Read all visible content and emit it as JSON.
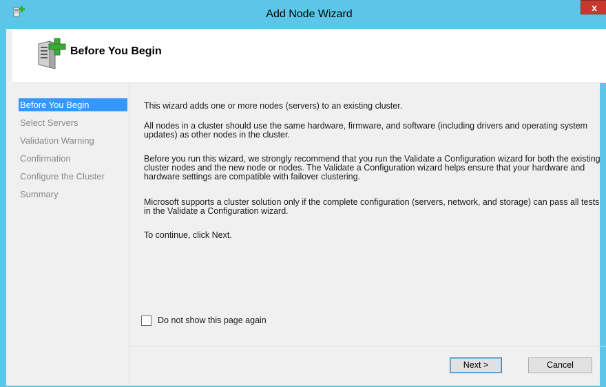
{
  "window": {
    "title": "Add Node Wizard",
    "close_label": "x",
    "app_icon": "add-node-icon",
    "accent_color": "#5bc6e8"
  },
  "header": {
    "title": "Before You Begin",
    "icon": "server-add-icon"
  },
  "sidebar": {
    "items": [
      {
        "label": "Before You Begin",
        "active": true
      },
      {
        "label": "Select Servers",
        "active": false
      },
      {
        "label": "Validation Warning",
        "active": false
      },
      {
        "label": "Confirmation",
        "active": false
      },
      {
        "label": "Configure the Cluster",
        "active": false
      },
      {
        "label": "Summary",
        "active": false
      }
    ],
    "selection_color": "#3399ff"
  },
  "content": {
    "paragraphs": [
      "This wizard adds one or more nodes (servers) to an existing cluster.",
      "All nodes in a cluster should use the same hardware, firmware, and software (including drivers and operating system updates) as other nodes in the cluster.",
      "Before you run this wizard, we strongly recommend that you run the Validate a Configuration wizard for both the existing cluster nodes and the new node or nodes. The Validate a Configuration wizard helps ensure that your hardware and hardware settings are compatible with failover clustering.",
      "Microsoft supports a cluster solution only if the complete configuration (servers, network, and storage) can pass all tests in the Validate a Configuration wizard.",
      "To continue, click Next."
    ]
  },
  "options": {
    "dont_show_label": "Do not show this page again",
    "dont_show_checked": false
  },
  "buttons": {
    "next": "Next >",
    "cancel": "Cancel"
  }
}
